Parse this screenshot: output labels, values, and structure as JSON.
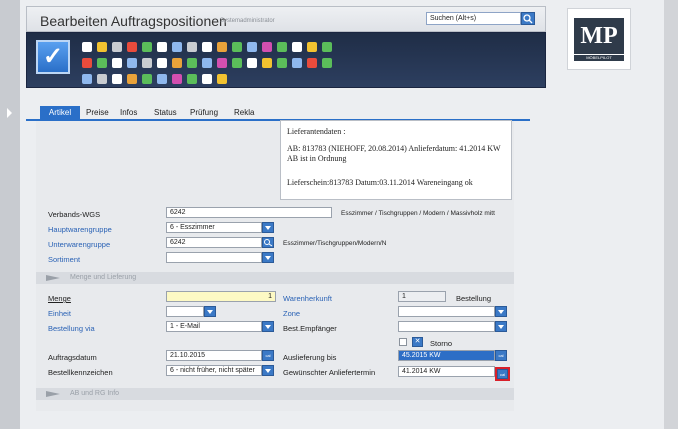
{
  "header": {
    "title": "Bearbeiten Auftragspositionen",
    "subtitle": "Systemadministrator",
    "search_placeholder": "Suchen (Alt+s)"
  },
  "logo": {
    "text": "MP",
    "subtext": "MÖBELPILOT"
  },
  "tabs": [
    "Artikel",
    "Preise",
    "Infos",
    "Status",
    "Prüfung",
    "Rekla"
  ],
  "info": {
    "line1": "Lieferantendaten :",
    "line2": "AB: 813783    (NIEHOFF, 20.08.2014)    Anlieferdatum: 41.2014 KW AB ist in Ordnung",
    "line3": "Lieferschein:813783 Datum:03.11.2014 Wareneingang ok"
  },
  "fields": {
    "verbands_wgs_label": "Verbands-WGS",
    "verbands_wgs_value": "6242",
    "verbands_wgs_desc": "Esszimmer / Tischgruppen / Modern / Massivholz mitt",
    "hauptwarengruppe_label": "Hauptwarengruppe",
    "hauptwarengruppe_value": "6 - Esszimmer",
    "unterwarengruppe_label": "Unterwarengruppe",
    "unterwarengruppe_value": "6242",
    "unterwarengruppe_desc": "Esszimmer/Tischgruppen/Modern/N",
    "sortiment_label": "Sortiment",
    "sortiment_value": ""
  },
  "section_menge": "Menge und Lieferung",
  "menge": {
    "menge_label": "Menge",
    "menge_value": "1",
    "einheit_label": "Einheit",
    "bestellung_via_label": "Bestellung via",
    "bestellung_via_value": "1 - E-Mail",
    "warenherkunft_label": "Warenherkunft",
    "warenherkunft_value": "1",
    "warenherkunft_desc": "Bestellung",
    "zone_label": "Zone",
    "best_empfaenger_label": "Best.Empfänger",
    "storno_label": "Storno",
    "auftragsdatum_label": "Auftragsdatum",
    "auftragsdatum_value": "21.10.2015",
    "bestellkennzeichen_label": "Bestellkennzeichen",
    "bestellkennzeichen_value": "6 - nicht früher, nicht später",
    "auslieferung_bis_label": "Auslieferung bis",
    "auslieferung_bis_value": "45.2015 KW",
    "anliefertermin_label": "Gewünschter Anliefertermin",
    "anliefertermin_value": "41.2014 KW"
  },
  "section_ab": "AB und RG Info"
}
